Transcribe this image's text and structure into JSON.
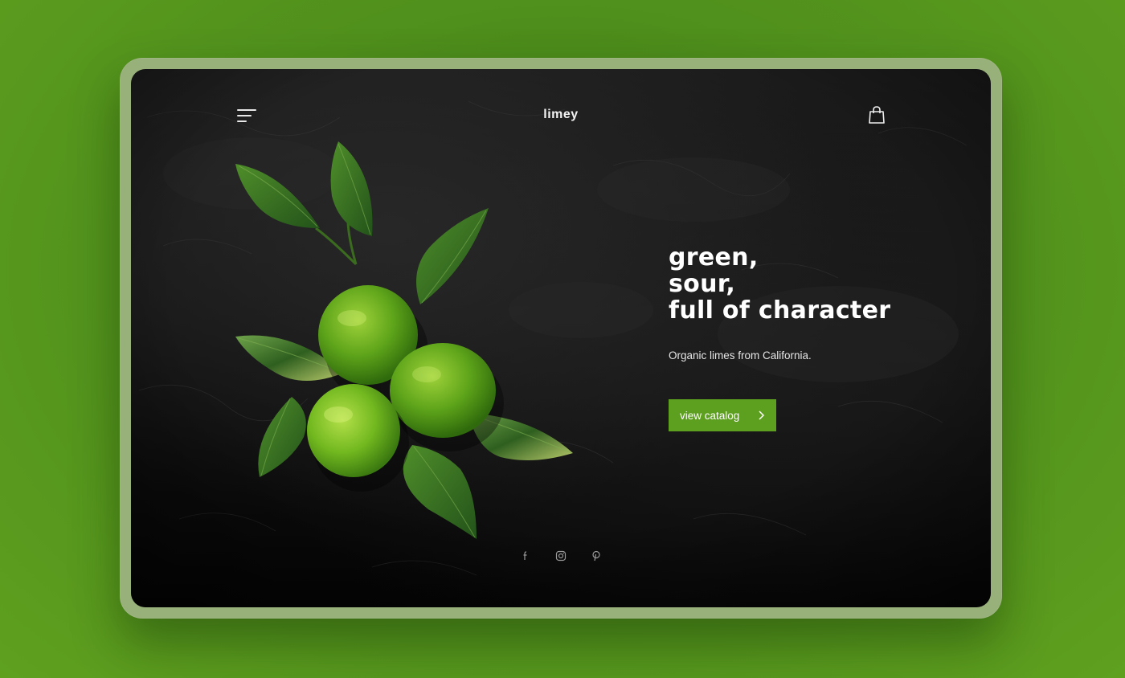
{
  "header": {
    "brand": "limey",
    "menu_icon": "hamburger-menu-icon",
    "cart_icon": "shopping-bag-icon"
  },
  "hero": {
    "headline_lines": [
      "green,",
      "sour,",
      "full of character"
    ],
    "subtext": "Organic limes from California.",
    "cta_label": "view catalog",
    "cta_icon": "chevron-right-icon"
  },
  "social": {
    "icons": [
      "facebook-icon",
      "instagram-icon",
      "pinterest-icon"
    ]
  },
  "colors": {
    "page_background": "#5a9a1e",
    "device_frame": "#98b07a",
    "screen_background": "#111111",
    "accent_button": "#5d9f1f",
    "text_primary": "#ffffff"
  }
}
